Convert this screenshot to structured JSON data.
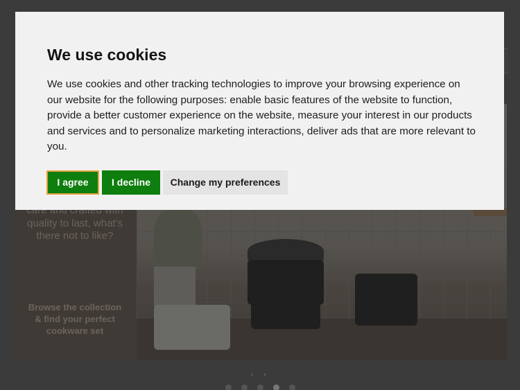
{
  "cookie": {
    "title": "We use cookies",
    "body": "We use cookies and other tracking technologies to improve your browsing experience on our website for the following purposes: enable basic features of the website to function, provide a better customer experience on the website, measure your interest in our products and services and to personalize marketing interactions, deliver ads that are more relevant to you.",
    "agree_label": "I agree",
    "decline_label": "I decline",
    "preferences_label": "Change my preferences",
    "accent_color": "#0e7e0e"
  },
  "background": {
    "tagline": "care and crafted with quality to last, what's there not to like?",
    "cta": "Browse the collection & find your perfect cookware set",
    "carousel_arrows": "‹ ›",
    "carousel_dot_count": 5,
    "carousel_active_dot": 4
  }
}
